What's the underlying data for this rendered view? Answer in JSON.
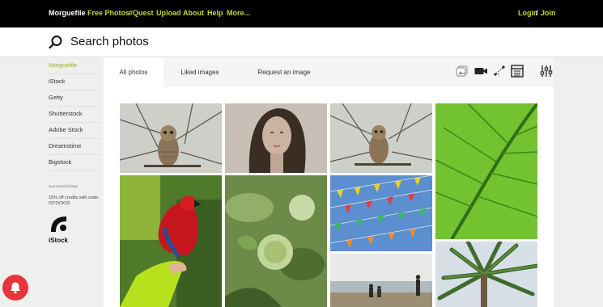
{
  "nav": {
    "brand": "Morguefile",
    "links": [
      "Free Photos",
      "#Quest",
      "Upload",
      "About",
      "Help",
      "More..."
    ],
    "login": "Login",
    "separator": "/",
    "join": "Join"
  },
  "search": {
    "placeholder": "Search photos"
  },
  "sidebar": {
    "items": [
      "Morguefile",
      "iStock",
      "Getty",
      "Shutterstock",
      "Adobe Stock",
      "Dreamstime",
      "Bigstock"
    ],
    "sponsored_label": "sponsored listings",
    "promo": "15% off credits with code: ISTOCK15",
    "logo_label": "iStock"
  },
  "tabs": [
    "All photos",
    "Liked images",
    "Request an image"
  ],
  "tools": [
    "image-gallery-icon",
    "video-camera-icon",
    "scatter-icon",
    "grid-layout-icon",
    "sliders-icon"
  ],
  "photos": [
    {
      "subject": "owl-on-branch-1"
    },
    {
      "subject": "woman-portrait-sepia"
    },
    {
      "subject": "owl-on-branch-2"
    },
    {
      "subject": "green-leaf"
    },
    {
      "subject": "red-parrot-on-hand"
    },
    {
      "subject": "green-plant-buds"
    },
    {
      "subject": "colorful-bunting-flags"
    },
    {
      "subject": "palm-tree"
    },
    {
      "subject": "people-on-beach"
    }
  ],
  "colors": {
    "accent": "#c3d72e",
    "nav_bg": "#000000",
    "bell": "#e8343b"
  }
}
